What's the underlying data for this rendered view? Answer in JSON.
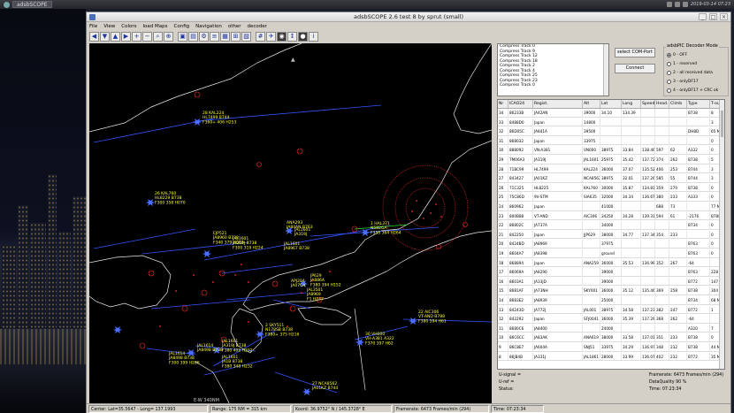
{
  "taskbar": {
    "task_label": "adsbSCOPE",
    "clock": "2019-03-14 07:23"
  },
  "window": {
    "title": "adsbSCOPE 2.6 test 8  by sprut  (small)"
  },
  "menu": [
    "File",
    "View",
    "Colors",
    "load Maps",
    "Config",
    "Navigation",
    "other",
    "decoder"
  ],
  "map": {
    "ew_label": "E-W  340NM",
    "planes": [
      {
        "lines": [
          "28  KAL224",
          "HL7499  B744",
          "F360+  406  H253"
        ]
      },
      {
        "lines": [
          "26  KAL760",
          "HL8229  B738",
          "F300  358  H070"
        ]
      },
      {
        "lines": [
          "EJP521",
          "JA8960 B738",
          "F340 379 H083"
        ]
      },
      {
        "lines": [
          "JAL1601",
          "JA319J B738",
          "F300 319 H224"
        ]
      },
      {
        "lines": [
          "ANA293",
          "JA84AN B763"
        ]
      },
      {
        "lines": [
          "JAL1601",
          "JA319J"
        ]
      },
      {
        "lines": [
          "JAL1601",
          "JA8967 B738"
        ]
      },
      {
        "lines": [
          "1  HAL371",
          "N582GA",
          "F355  364  H264"
        ]
      },
      {
        "lines": [
          "JP629",
          "JA886A",
          "F380 394 H152"
        ]
      },
      {
        "lines": [
          "APJ204",
          "JA07CA"
        ]
      },
      {
        "lines": [
          "JAL3501",
          "JA8969",
          "F1  H247"
        ]
      },
      {
        "lines": [
          "2  SKY511",
          "N178SB B738",
          "F380+ 375 H216"
        ]
      },
      {
        "lines": [
          "JAL1601",
          "JA319J  B738",
          "F380  402  H232"
        ]
      },
      {
        "lines": [
          "JAL1601",
          "JA1B   B738",
          "F380  348  H232"
        ]
      },
      {
        "lines": [
          "JAL1614",
          "JA8498 B738"
        ]
      },
      {
        "lines": [
          "JAL1614",
          "JA8498  B738",
          "F300  399  H286"
        ]
      },
      {
        "lines": [
          "30  VH000",
          "VH-A381  A322",
          "F370  397  H62"
        ]
      },
      {
        "lines": [
          "22  AIC306",
          "VT-AND  B788",
          "F380  594  H61"
        ]
      },
      {
        "lines": [
          "27  NCA8562",
          "JA01KZ  B744"
        ]
      }
    ]
  },
  "tracks": [
    "Compress Track 0",
    "Compress Track 9",
    "Compress Track 12",
    "Compress Track 18",
    "Compress Track 2",
    "Compress Track 4",
    "Compress Track 25",
    "Compress Track 23",
    "Compress Track 0"
  ],
  "buttons": {
    "com_port": "select COM-Port",
    "connect": "Connect"
  },
  "decoder": {
    "title": "adsbPIC Decoder Mode",
    "options": [
      {
        "label": "0 - OFF",
        "selected": true
      },
      {
        "label": "1 - reserved",
        "selected": false
      },
      {
        "label": "2 - all received data",
        "selected": false
      },
      {
        "label": "3 - onlyDF17",
        "selected": false
      },
      {
        "label": "4 - onlyDF17 + CRC ok",
        "selected": false
      }
    ]
  },
  "table": {
    "headers": [
      "Nr",
      "ICAO24",
      "Regist.",
      "Alt",
      "Lat",
      "Long",
      "Speed",
      "Head.",
      "Climb",
      "Type",
      "T-out"
    ],
    "rows": [
      [
        "34",
        "86233B",
        "JA42AN",
        "39000",
        "34.10",
        "134.39",
        "",
        "",
        "",
        "B738",
        "8"
      ],
      [
        "33",
        "8488D0",
        "Japan",
        "14800",
        "",
        "",
        "",
        "",
        "",
        "",
        "3"
      ],
      [
        "32",
        "86D05C",
        "JA841A",
        "39500",
        "",
        "",
        "",
        "",
        "",
        "DH8D",
        "65 M"
      ],
      [
        "31",
        "868032",
        "Japan",
        "33975",
        "",
        "",
        "",
        "",
        "",
        "",
        "0"
      ],
      [
        "30",
        "888092",
        "VN-A381",
        "VN000",
        "38975",
        "33.84",
        "138.46",
        "597",
        "62",
        "A332",
        "0"
      ],
      [
        "29",
        "7M06A3",
        "JA319J",
        "JAL1601",
        "25975",
        "35.42",
        "137.72",
        "374",
        "262",
        "B738",
        "5"
      ],
      [
        "28",
        "71BC99",
        "HL7499",
        "KAL224",
        "36000",
        "37.07",
        "135.52",
        "406",
        "253",
        "B744",
        "3"
      ],
      [
        "27",
        "843427",
        "JA01KZ",
        "NCA8562",
        "38975",
        "32.01",
        "137.26",
        "585",
        "55",
        "B744",
        "3"
      ],
      [
        "26",
        "71C325",
        "HL8225",
        "KAL760",
        "30000",
        "35.87",
        "134.81",
        "359",
        "270",
        "B738",
        "0"
      ],
      [
        "25",
        "75C86D",
        "9V-STM",
        "SIA635",
        "32000",
        "34.34",
        "136.67",
        "380",
        "233",
        "A333",
        "0"
      ],
      [
        "24",
        "860962",
        "Japan",
        "",
        "41000",
        "",
        "",
        "688",
        "73",
        "",
        "77 M"
      ],
      [
        "23",
        "800B88",
        "VT-AND",
        "AIC306",
        "34250",
        "34.28",
        "139.31",
        "594",
        "61",
        "-2176",
        "B788",
        "4"
      ],
      [
        "22",
        "86802C",
        "JA737A",
        "",
        "34000",
        "",
        "",
        "",
        "",
        "B734",
        "0"
      ],
      [
        "21",
        "842250",
        "Japan",
        "JJP629",
        "38000",
        "34.77",
        "137.34",
        "354",
        "233",
        "",
        "0"
      ],
      [
        "20",
        "8424BD",
        "JA8969",
        "",
        "37975",
        "",
        "",
        "",
        "",
        "B763",
        "0"
      ],
      [
        "19",
        "8604A7",
        "JA8398",
        "",
        "ground",
        "",
        "",
        "",
        "",
        "B763",
        "0"
      ],
      [
        "18",
        "868894",
        "Japan",
        "ANA259",
        "36000",
        "35.53",
        "136.99",
        "352",
        "267",
        "-64",
        "",
        "1"
      ],
      [
        "17",
        "86069A",
        "JA8290",
        "",
        "39000",
        "",
        "",
        "",
        "",
        "B763",
        "228 M"
      ],
      [
        "16",
        "8603A1",
        "JA33JD",
        "",
        "39000",
        "",
        "",
        "",
        "",
        "B772",
        "147 M"
      ],
      [
        "15",
        "8681AF",
        "JA73NH",
        "SKY001",
        "36000",
        "35.12",
        "135.46",
        "369",
        "258",
        "B738",
        "304 M"
      ],
      [
        "14",
        "8683E2",
        "JA8939",
        "",
        "25000",
        "",
        "",
        "",
        "",
        "B734",
        "68 M"
      ],
      [
        "13",
        "84243D",
        "JA772J",
        "JAL001",
        "38975",
        "34.58",
        "137.23",
        "382",
        "247",
        "B772",
        "1"
      ],
      [
        "12",
        "842292",
        "Japan",
        "SFJ0041",
        "36000",
        "35.39",
        "137.29",
        "368",
        "262",
        "-64",
        "",
        "0"
      ],
      [
        "11",
        "8680C6",
        "JA8400",
        "",
        "24000",
        "",
        "",
        "",
        "",
        "A320",
        "7"
      ],
      [
        "10",
        "86C6CC",
        "JA83AK",
        "ANA619",
        "38000",
        "33.58",
        "137.01",
        "351",
        "233",
        "B738",
        "0"
      ],
      [
        "9",
        "86C8E7",
        "JA604A",
        "SNJ51",
        "33975",
        "34.29",
        "136.97",
        "348",
        "232",
        "B738",
        "44 M"
      ],
      [
        "8",
        "86JB4B",
        "JA331J",
        "JAL1861",
        "28000",
        "33.99",
        "136.07",
        "402",
        "232",
        "B772",
        "35 M"
      ]
    ]
  },
  "info": {
    "u_signal": "U-signal =",
    "u_ref": "U-ref =",
    "status": "Status:",
    "framerate": "Framerate:  6473 Frames/min (294)",
    "quality": "DataQuality  90 %",
    "time": "Time: 07:23:34"
  },
  "status": {
    "center": "Center: Lat=35.5647 - Long= 137.1993",
    "range": "Range: 175 NM = 315 km",
    "coords": "Koord: 36.9752° N / 145.3728° E",
    "framerate": "Framerate: 6473 Frames/min (294)",
    "time": "Time: 07:23:34"
  },
  "colors": {
    "map_bg": "#000000",
    "coast": "#e8e8e8",
    "track_line": "#3355ff",
    "label": "#ffff33",
    "range_ring": "#ff2a2a"
  }
}
